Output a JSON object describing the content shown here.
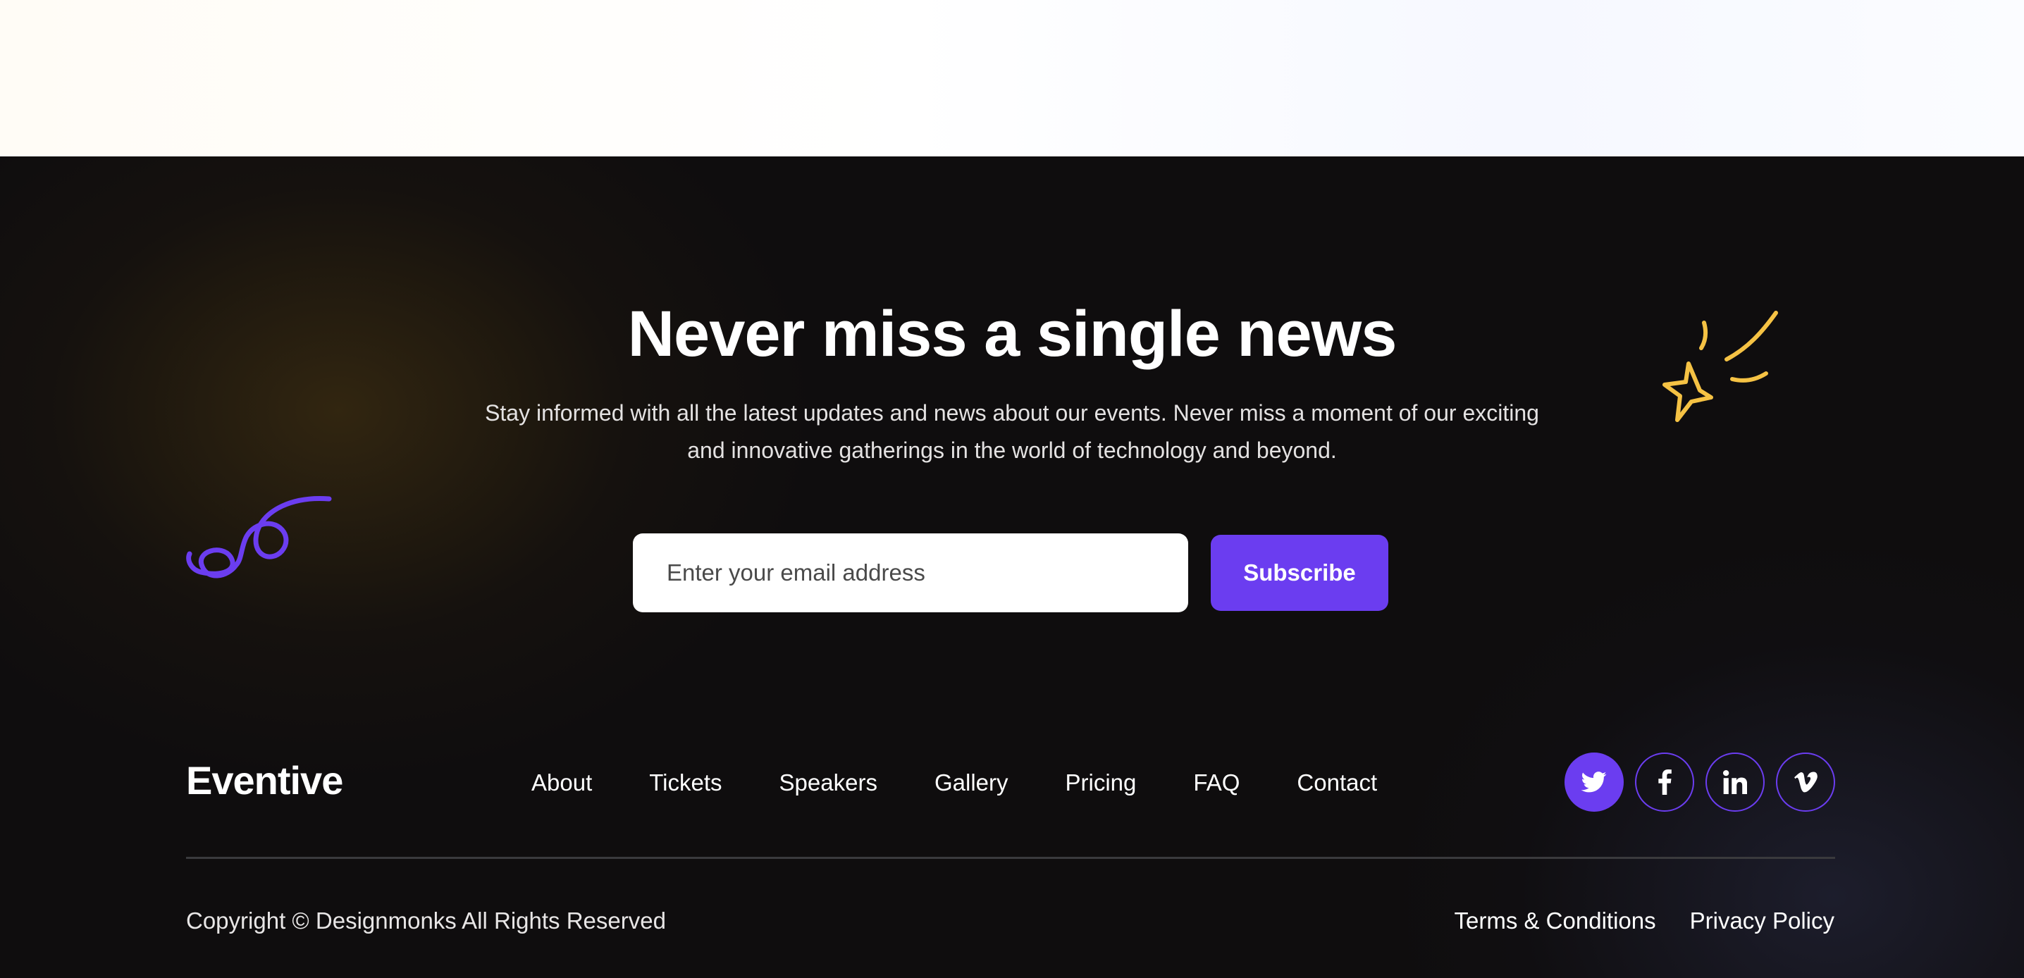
{
  "newsletter": {
    "title": "Never miss a single news",
    "description": "Stay informed with all the latest updates and news about our events. Never miss a moment of our exciting and innovative gatherings in the world of technology and beyond.",
    "email_placeholder": "Enter your email address",
    "subscribe_label": "Subscribe"
  },
  "footer": {
    "logo": "Eventive",
    "nav": [
      {
        "label": "About"
      },
      {
        "label": "Tickets"
      },
      {
        "label": "Speakers"
      },
      {
        "label": "Gallery"
      },
      {
        "label": "Pricing"
      },
      {
        "label": "FAQ"
      },
      {
        "label": "Contact"
      }
    ],
    "socials": [
      {
        "icon": "twitter-icon",
        "active": true
      },
      {
        "icon": "facebook-icon",
        "active": false
      },
      {
        "icon": "linkedin-icon",
        "active": false
      },
      {
        "icon": "vimeo-icon",
        "active": false
      }
    ],
    "copyright": "Copyright © Designmonks All Rights Reserved",
    "legal": [
      {
        "label": "Terms & Conditions"
      },
      {
        "label": "Privacy Policy"
      }
    ]
  },
  "colors": {
    "accent": "#6b3df0",
    "sparkle": "#f5c244",
    "footer_bg": "#0f0d0e"
  }
}
